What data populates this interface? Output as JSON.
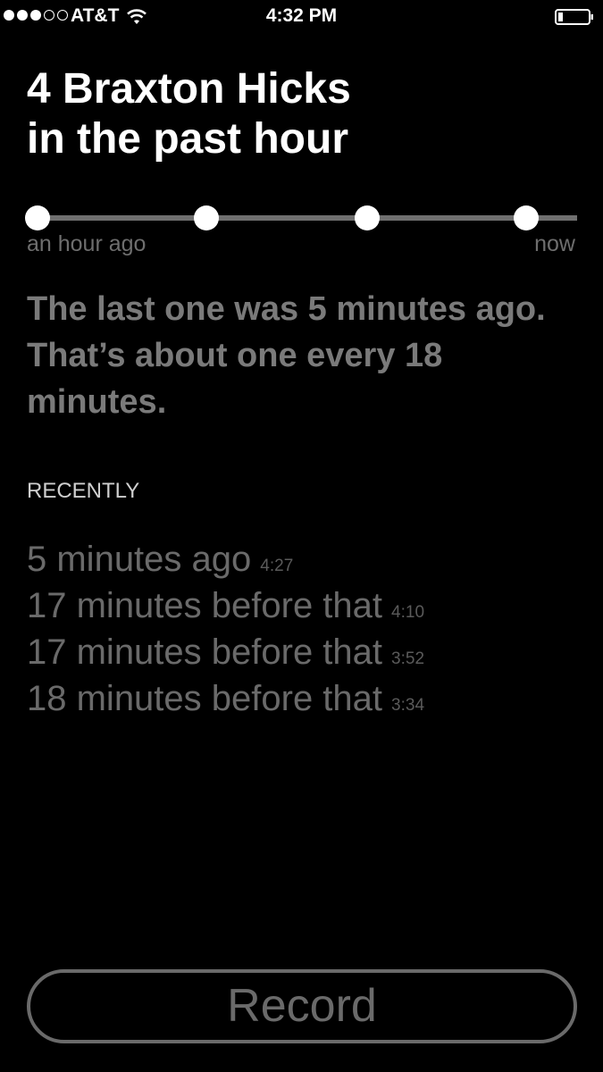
{
  "status_bar": {
    "signal_bars_filled": 3,
    "signal_bars_total": 5,
    "carrier": "AT&T",
    "wifi_icon": "wifi-icon",
    "time": "4:32 PM",
    "battery_icon": "battery-icon",
    "battery_level": 0.15
  },
  "title": {
    "line1": "4 Braxton Hicks",
    "line2": "in the past hour"
  },
  "timeline": {
    "start_label": "an hour ago",
    "end_label": "now",
    "events": [
      "3:34",
      "3:52",
      "4:10",
      "4:27"
    ]
  },
  "summary": "The last one was 5 minutes ago. That’s about one every 18 minutes.",
  "recently": {
    "heading": "RECENTLY",
    "items": [
      {
        "description": "5 minutes ago",
        "time": "4:27"
      },
      {
        "description": "17 minutes before that",
        "time": "4:10"
      },
      {
        "description": "17 minutes before that",
        "time": "3:52"
      },
      {
        "description": "18 minutes before that",
        "time": "3:34"
      }
    ]
  },
  "record_button": {
    "label": "Record"
  },
  "colors": {
    "background": "#000000",
    "primary_text": "#ffffff",
    "muted_text": "#7a7a7a",
    "timeline_track": "#6f6f6f"
  }
}
